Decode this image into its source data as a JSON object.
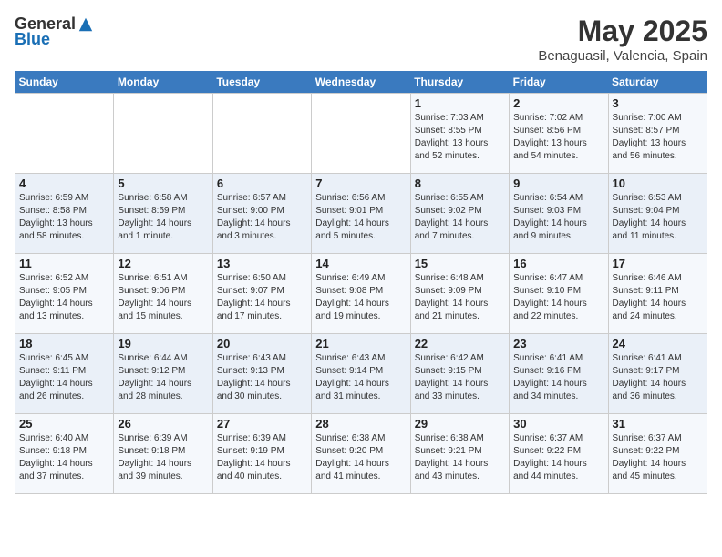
{
  "header": {
    "logo_general": "General",
    "logo_blue": "Blue",
    "month_title": "May 2025",
    "subtitle": "Benaguasil, Valencia, Spain"
  },
  "weekdays": [
    "Sunday",
    "Monday",
    "Tuesday",
    "Wednesday",
    "Thursday",
    "Friday",
    "Saturday"
  ],
  "weeks": [
    [
      {
        "day": "",
        "sunrise": "",
        "sunset": "",
        "daylight": ""
      },
      {
        "day": "",
        "sunrise": "",
        "sunset": "",
        "daylight": ""
      },
      {
        "day": "",
        "sunrise": "",
        "sunset": "",
        "daylight": ""
      },
      {
        "day": "",
        "sunrise": "",
        "sunset": "",
        "daylight": ""
      },
      {
        "day": "1",
        "sunrise": "Sunrise: 7:03 AM",
        "sunset": "Sunset: 8:55 PM",
        "daylight": "Daylight: 13 hours and 52 minutes."
      },
      {
        "day": "2",
        "sunrise": "Sunrise: 7:02 AM",
        "sunset": "Sunset: 8:56 PM",
        "daylight": "Daylight: 13 hours and 54 minutes."
      },
      {
        "day": "3",
        "sunrise": "Sunrise: 7:00 AM",
        "sunset": "Sunset: 8:57 PM",
        "daylight": "Daylight: 13 hours and 56 minutes."
      }
    ],
    [
      {
        "day": "4",
        "sunrise": "Sunrise: 6:59 AM",
        "sunset": "Sunset: 8:58 PM",
        "daylight": "Daylight: 13 hours and 58 minutes."
      },
      {
        "day": "5",
        "sunrise": "Sunrise: 6:58 AM",
        "sunset": "Sunset: 8:59 PM",
        "daylight": "Daylight: 14 hours and 1 minute."
      },
      {
        "day": "6",
        "sunrise": "Sunrise: 6:57 AM",
        "sunset": "Sunset: 9:00 PM",
        "daylight": "Daylight: 14 hours and 3 minutes."
      },
      {
        "day": "7",
        "sunrise": "Sunrise: 6:56 AM",
        "sunset": "Sunset: 9:01 PM",
        "daylight": "Daylight: 14 hours and 5 minutes."
      },
      {
        "day": "8",
        "sunrise": "Sunrise: 6:55 AM",
        "sunset": "Sunset: 9:02 PM",
        "daylight": "Daylight: 14 hours and 7 minutes."
      },
      {
        "day": "9",
        "sunrise": "Sunrise: 6:54 AM",
        "sunset": "Sunset: 9:03 PM",
        "daylight": "Daylight: 14 hours and 9 minutes."
      },
      {
        "day": "10",
        "sunrise": "Sunrise: 6:53 AM",
        "sunset": "Sunset: 9:04 PM",
        "daylight": "Daylight: 14 hours and 11 minutes."
      }
    ],
    [
      {
        "day": "11",
        "sunrise": "Sunrise: 6:52 AM",
        "sunset": "Sunset: 9:05 PM",
        "daylight": "Daylight: 14 hours and 13 minutes."
      },
      {
        "day": "12",
        "sunrise": "Sunrise: 6:51 AM",
        "sunset": "Sunset: 9:06 PM",
        "daylight": "Daylight: 14 hours and 15 minutes."
      },
      {
        "day": "13",
        "sunrise": "Sunrise: 6:50 AM",
        "sunset": "Sunset: 9:07 PM",
        "daylight": "Daylight: 14 hours and 17 minutes."
      },
      {
        "day": "14",
        "sunrise": "Sunrise: 6:49 AM",
        "sunset": "Sunset: 9:08 PM",
        "daylight": "Daylight: 14 hours and 19 minutes."
      },
      {
        "day": "15",
        "sunrise": "Sunrise: 6:48 AM",
        "sunset": "Sunset: 9:09 PM",
        "daylight": "Daylight: 14 hours and 21 minutes."
      },
      {
        "day": "16",
        "sunrise": "Sunrise: 6:47 AM",
        "sunset": "Sunset: 9:10 PM",
        "daylight": "Daylight: 14 hours and 22 minutes."
      },
      {
        "day": "17",
        "sunrise": "Sunrise: 6:46 AM",
        "sunset": "Sunset: 9:11 PM",
        "daylight": "Daylight: 14 hours and 24 minutes."
      }
    ],
    [
      {
        "day": "18",
        "sunrise": "Sunrise: 6:45 AM",
        "sunset": "Sunset: 9:11 PM",
        "daylight": "Daylight: 14 hours and 26 minutes."
      },
      {
        "day": "19",
        "sunrise": "Sunrise: 6:44 AM",
        "sunset": "Sunset: 9:12 PM",
        "daylight": "Daylight: 14 hours and 28 minutes."
      },
      {
        "day": "20",
        "sunrise": "Sunrise: 6:43 AM",
        "sunset": "Sunset: 9:13 PM",
        "daylight": "Daylight: 14 hours and 30 minutes."
      },
      {
        "day": "21",
        "sunrise": "Sunrise: 6:43 AM",
        "sunset": "Sunset: 9:14 PM",
        "daylight": "Daylight: 14 hours and 31 minutes."
      },
      {
        "day": "22",
        "sunrise": "Sunrise: 6:42 AM",
        "sunset": "Sunset: 9:15 PM",
        "daylight": "Daylight: 14 hours and 33 minutes."
      },
      {
        "day": "23",
        "sunrise": "Sunrise: 6:41 AM",
        "sunset": "Sunset: 9:16 PM",
        "daylight": "Daylight: 14 hours and 34 minutes."
      },
      {
        "day": "24",
        "sunrise": "Sunrise: 6:41 AM",
        "sunset": "Sunset: 9:17 PM",
        "daylight": "Daylight: 14 hours and 36 minutes."
      }
    ],
    [
      {
        "day": "25",
        "sunrise": "Sunrise: 6:40 AM",
        "sunset": "Sunset: 9:18 PM",
        "daylight": "Daylight: 14 hours and 37 minutes."
      },
      {
        "day": "26",
        "sunrise": "Sunrise: 6:39 AM",
        "sunset": "Sunset: 9:18 PM",
        "daylight": "Daylight: 14 hours and 39 minutes."
      },
      {
        "day": "27",
        "sunrise": "Sunrise: 6:39 AM",
        "sunset": "Sunset: 9:19 PM",
        "daylight": "Daylight: 14 hours and 40 minutes."
      },
      {
        "day": "28",
        "sunrise": "Sunrise: 6:38 AM",
        "sunset": "Sunset: 9:20 PM",
        "daylight": "Daylight: 14 hours and 41 minutes."
      },
      {
        "day": "29",
        "sunrise": "Sunrise: 6:38 AM",
        "sunset": "Sunset: 9:21 PM",
        "daylight": "Daylight: 14 hours and 43 minutes."
      },
      {
        "day": "30",
        "sunrise": "Sunrise: 6:37 AM",
        "sunset": "Sunset: 9:22 PM",
        "daylight": "Daylight: 14 hours and 44 minutes."
      },
      {
        "day": "31",
        "sunrise": "Sunrise: 6:37 AM",
        "sunset": "Sunset: 9:22 PM",
        "daylight": "Daylight: 14 hours and 45 minutes."
      }
    ]
  ]
}
